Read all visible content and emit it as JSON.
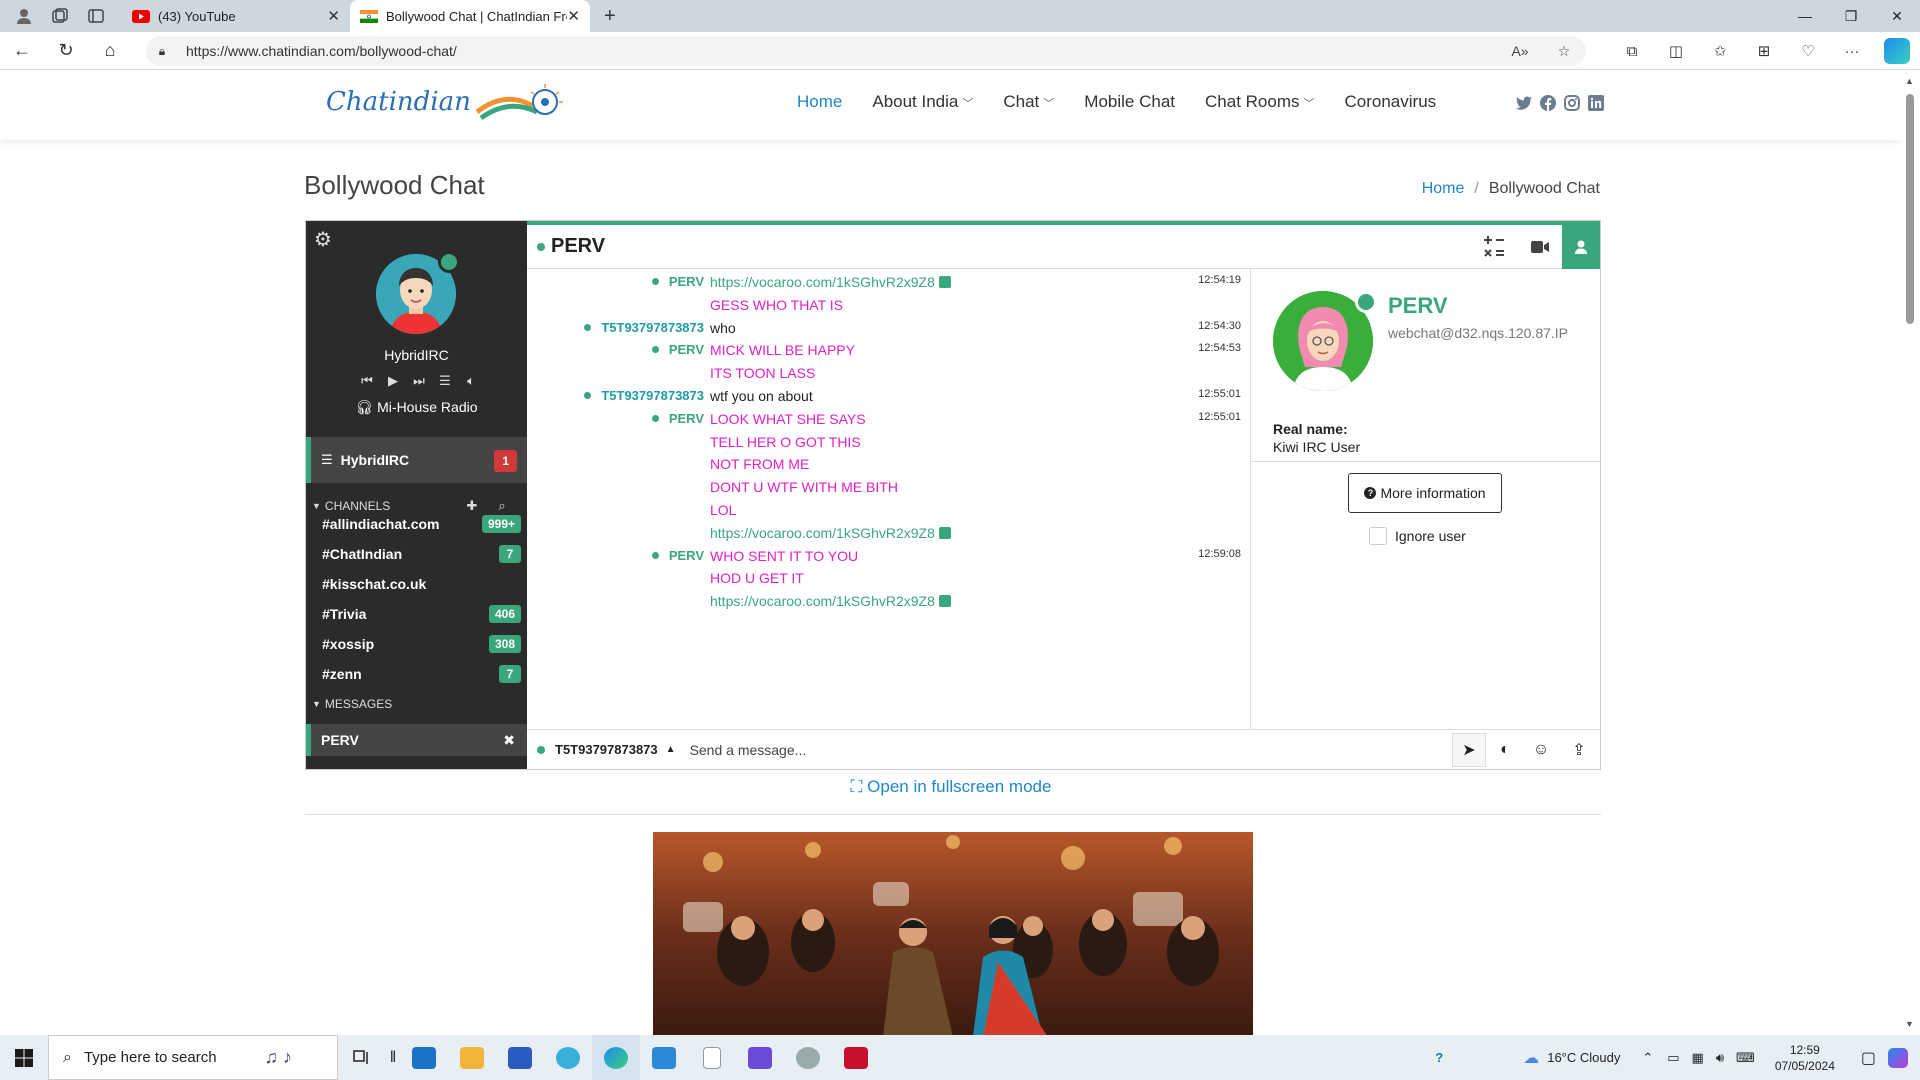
{
  "browser": {
    "tabs": [
      {
        "title": "(43) YouTube",
        "icon": "youtube-icon"
      },
      {
        "title": "Bollywood Chat | ChatIndian Free",
        "icon": "india-flag-icon"
      }
    ],
    "url": "https://www.chatindian.com/bollywood-chat/"
  },
  "site": {
    "logo_text": "Chatindian",
    "nav": [
      {
        "label": "Home",
        "active": true,
        "caret": false
      },
      {
        "label": "About India",
        "caret": true
      },
      {
        "label": "Chat",
        "caret": true
      },
      {
        "label": "Mobile Chat",
        "caret": false
      },
      {
        "label": "Chat Rooms",
        "caret": true
      },
      {
        "label": "Coronavirus",
        "caret": false
      }
    ],
    "social": [
      "twitter-icon",
      "facebook-icon",
      "instagram-icon",
      "linkedin-icon"
    ],
    "page_title": "Bollywood Chat",
    "breadcrumb": {
      "home": "Home",
      "sep": "/",
      "current": "Bollywood Chat"
    },
    "fullscreen_link": "Open in fullscreen mode"
  },
  "chat": {
    "me": {
      "name": "HybridIRC",
      "radio": "Mi-House Radio"
    },
    "network": {
      "name": "HybridIRC",
      "count": "1"
    },
    "channels_header": "CHANNELS",
    "channels": [
      {
        "name": "#allindiachat.com",
        "count": "999+"
      },
      {
        "name": "#ChatIndian",
        "count": "7"
      },
      {
        "name": "#kisschat.co.uk",
        "count": ""
      },
      {
        "name": "#Trivia",
        "count": "406"
      },
      {
        "name": "#xossip",
        "count": "308"
      },
      {
        "name": "#zenn",
        "count": "7"
      }
    ],
    "messages_header": "MESSAGES",
    "pm": {
      "name": "PERV"
    },
    "header_name": "PERV",
    "messages": [
      {
        "nick": "PERV",
        "nick_color": "green",
        "text": "https://vocaroo.com/1kSGhvR2x9Z8",
        "type": "link",
        "time": "12:54:19"
      },
      {
        "nick": "",
        "text": "GESS WHO THAT IS",
        "type": "pink",
        "time": ""
      },
      {
        "nick": "T5T93797873873",
        "nick_color": "teal",
        "text": "who",
        "type": "plain",
        "time": "12:54:30"
      },
      {
        "nick": "PERV",
        "nick_color": "green",
        "text": "MICK WILL BE HAPPY",
        "type": "pink",
        "time": "12:54:53"
      },
      {
        "nick": "",
        "text": "ITS TOON LASS",
        "type": "pink",
        "time": ""
      },
      {
        "nick": "T5T93797873873",
        "nick_color": "teal",
        "text": "wtf you on about",
        "type": "plain",
        "time": "12:55:01"
      },
      {
        "nick": "PERV",
        "nick_color": "green",
        "text": "LOOK WHAT SHE SAYS",
        "type": "pink",
        "time": "12:55:01"
      },
      {
        "nick": "",
        "text": "TELL HER O GOT THIS",
        "type": "pink",
        "time": ""
      },
      {
        "nick": "",
        "text": "NOT FROM ME",
        "type": "pink",
        "time": ""
      },
      {
        "nick": "",
        "text": "DONT U WTF WITH ME BITH",
        "type": "pink",
        "time": ""
      },
      {
        "nick": "",
        "text": "LOL",
        "type": "pink",
        "time": ""
      },
      {
        "nick": "",
        "text": "https://vocaroo.com/1kSGhvR2x9Z8",
        "type": "link",
        "time": ""
      },
      {
        "nick": "PERV",
        "nick_color": "green",
        "text": "WHO SENT IT TO YOU",
        "type": "pink",
        "time": "12:59:08"
      },
      {
        "nick": "",
        "text": "HOD U GET IT",
        "type": "pink",
        "time": ""
      },
      {
        "nick": "",
        "text": "https://vocaroo.com/1kSGhvR2x9Z8",
        "type": "link",
        "time": ""
      }
    ],
    "user_panel": {
      "name": "PERV",
      "host": "webchat@d32.nqs.120.87.IP",
      "realname_label": "Real name:",
      "realname": "Kiwi IRC User",
      "more_info": "More information",
      "ignore": "Ignore user"
    },
    "input": {
      "nick": "T5T93797873873",
      "placeholder": "Send a message..."
    }
  },
  "taskbar": {
    "search_placeholder": "Type here to search",
    "weather": "16°C  Cloudy",
    "time": "12:59",
    "date": "07/05/2024"
  },
  "colors": {
    "accent": "#3aa67c",
    "link_blue": "#1e88c7",
    "pink": "#e020c8",
    "sidebar": "#2b2b2b"
  }
}
